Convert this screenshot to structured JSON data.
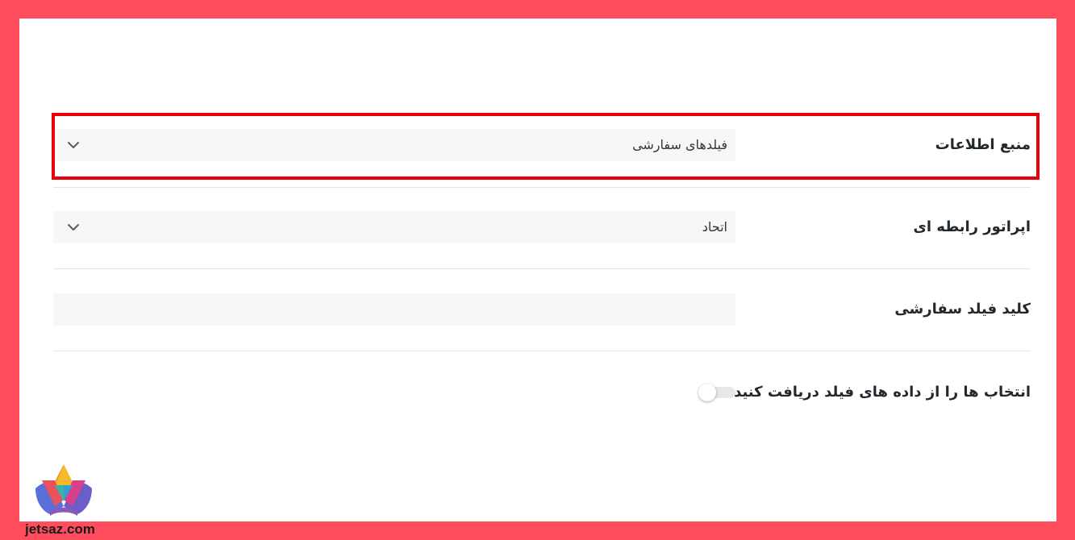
{
  "form": {
    "data_source": {
      "label": "منبع اطلاعات",
      "value": "فیلدهای سفارشی"
    },
    "relation_operator": {
      "label": "اپراتور رابطه ای",
      "value": "اتحاد"
    },
    "custom_field_key": {
      "label": "کلید فیلد سفارشی",
      "value": ""
    },
    "fetch_options": {
      "label": "انتخاب ها را از داده های فیلد دریافت کنید",
      "enabled": false
    }
  },
  "icons": {
    "dropdown": "chevron-down-icon",
    "logo": "jetsaz-logo"
  },
  "watermark": "jetsaz.com",
  "colors": {
    "frame": "#ff4d5e",
    "highlight": "#e8000b",
    "field_bg": "#f7f7f7"
  }
}
